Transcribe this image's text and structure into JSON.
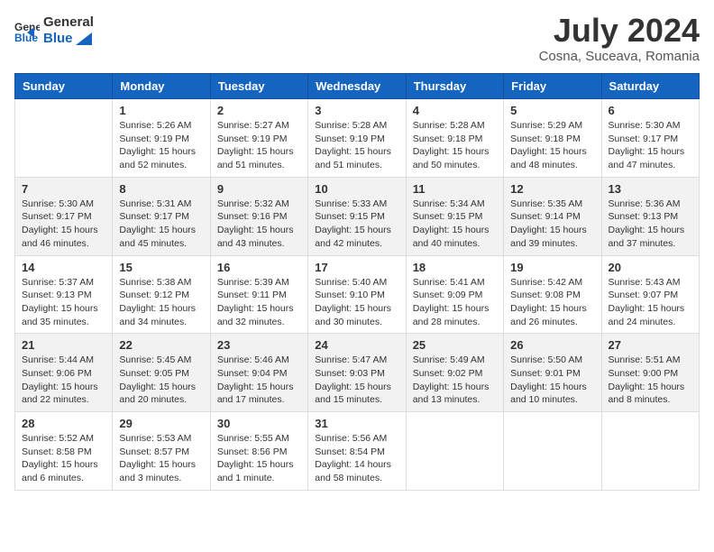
{
  "header": {
    "logo_line1": "General",
    "logo_line2": "Blue",
    "month_year": "July 2024",
    "location": "Cosna, Suceava, Romania"
  },
  "weekdays": [
    "Sunday",
    "Monday",
    "Tuesday",
    "Wednesday",
    "Thursday",
    "Friday",
    "Saturday"
  ],
  "weeks": [
    [
      {
        "day": "",
        "sunrise": "",
        "sunset": "",
        "daylight": ""
      },
      {
        "day": "1",
        "sunrise": "Sunrise: 5:26 AM",
        "sunset": "Sunset: 9:19 PM",
        "daylight": "Daylight: 15 hours and 52 minutes."
      },
      {
        "day": "2",
        "sunrise": "Sunrise: 5:27 AM",
        "sunset": "Sunset: 9:19 PM",
        "daylight": "Daylight: 15 hours and 51 minutes."
      },
      {
        "day": "3",
        "sunrise": "Sunrise: 5:28 AM",
        "sunset": "Sunset: 9:19 PM",
        "daylight": "Daylight: 15 hours and 51 minutes."
      },
      {
        "day": "4",
        "sunrise": "Sunrise: 5:28 AM",
        "sunset": "Sunset: 9:18 PM",
        "daylight": "Daylight: 15 hours and 50 minutes."
      },
      {
        "day": "5",
        "sunrise": "Sunrise: 5:29 AM",
        "sunset": "Sunset: 9:18 PM",
        "daylight": "Daylight: 15 hours and 48 minutes."
      },
      {
        "day": "6",
        "sunrise": "Sunrise: 5:30 AM",
        "sunset": "Sunset: 9:17 PM",
        "daylight": "Daylight: 15 hours and 47 minutes."
      }
    ],
    [
      {
        "day": "7",
        "sunrise": "Sunrise: 5:30 AM",
        "sunset": "Sunset: 9:17 PM",
        "daylight": "Daylight: 15 hours and 46 minutes."
      },
      {
        "day": "8",
        "sunrise": "Sunrise: 5:31 AM",
        "sunset": "Sunset: 9:17 PM",
        "daylight": "Daylight: 15 hours and 45 minutes."
      },
      {
        "day": "9",
        "sunrise": "Sunrise: 5:32 AM",
        "sunset": "Sunset: 9:16 PM",
        "daylight": "Daylight: 15 hours and 43 minutes."
      },
      {
        "day": "10",
        "sunrise": "Sunrise: 5:33 AM",
        "sunset": "Sunset: 9:15 PM",
        "daylight": "Daylight: 15 hours and 42 minutes."
      },
      {
        "day": "11",
        "sunrise": "Sunrise: 5:34 AM",
        "sunset": "Sunset: 9:15 PM",
        "daylight": "Daylight: 15 hours and 40 minutes."
      },
      {
        "day": "12",
        "sunrise": "Sunrise: 5:35 AM",
        "sunset": "Sunset: 9:14 PM",
        "daylight": "Daylight: 15 hours and 39 minutes."
      },
      {
        "day": "13",
        "sunrise": "Sunrise: 5:36 AM",
        "sunset": "Sunset: 9:13 PM",
        "daylight": "Daylight: 15 hours and 37 minutes."
      }
    ],
    [
      {
        "day": "14",
        "sunrise": "Sunrise: 5:37 AM",
        "sunset": "Sunset: 9:13 PM",
        "daylight": "Daylight: 15 hours and 35 minutes."
      },
      {
        "day": "15",
        "sunrise": "Sunrise: 5:38 AM",
        "sunset": "Sunset: 9:12 PM",
        "daylight": "Daylight: 15 hours and 34 minutes."
      },
      {
        "day": "16",
        "sunrise": "Sunrise: 5:39 AM",
        "sunset": "Sunset: 9:11 PM",
        "daylight": "Daylight: 15 hours and 32 minutes."
      },
      {
        "day": "17",
        "sunrise": "Sunrise: 5:40 AM",
        "sunset": "Sunset: 9:10 PM",
        "daylight": "Daylight: 15 hours and 30 minutes."
      },
      {
        "day": "18",
        "sunrise": "Sunrise: 5:41 AM",
        "sunset": "Sunset: 9:09 PM",
        "daylight": "Daylight: 15 hours and 28 minutes."
      },
      {
        "day": "19",
        "sunrise": "Sunrise: 5:42 AM",
        "sunset": "Sunset: 9:08 PM",
        "daylight": "Daylight: 15 hours and 26 minutes."
      },
      {
        "day": "20",
        "sunrise": "Sunrise: 5:43 AM",
        "sunset": "Sunset: 9:07 PM",
        "daylight": "Daylight: 15 hours and 24 minutes."
      }
    ],
    [
      {
        "day": "21",
        "sunrise": "Sunrise: 5:44 AM",
        "sunset": "Sunset: 9:06 PM",
        "daylight": "Daylight: 15 hours and 22 minutes."
      },
      {
        "day": "22",
        "sunrise": "Sunrise: 5:45 AM",
        "sunset": "Sunset: 9:05 PM",
        "daylight": "Daylight: 15 hours and 20 minutes."
      },
      {
        "day": "23",
        "sunrise": "Sunrise: 5:46 AM",
        "sunset": "Sunset: 9:04 PM",
        "daylight": "Daylight: 15 hours and 17 minutes."
      },
      {
        "day": "24",
        "sunrise": "Sunrise: 5:47 AM",
        "sunset": "Sunset: 9:03 PM",
        "daylight": "Daylight: 15 hours and 15 minutes."
      },
      {
        "day": "25",
        "sunrise": "Sunrise: 5:49 AM",
        "sunset": "Sunset: 9:02 PM",
        "daylight": "Daylight: 15 hours and 13 minutes."
      },
      {
        "day": "26",
        "sunrise": "Sunrise: 5:50 AM",
        "sunset": "Sunset: 9:01 PM",
        "daylight": "Daylight: 15 hours and 10 minutes."
      },
      {
        "day": "27",
        "sunrise": "Sunrise: 5:51 AM",
        "sunset": "Sunset: 9:00 PM",
        "daylight": "Daylight: 15 hours and 8 minutes."
      }
    ],
    [
      {
        "day": "28",
        "sunrise": "Sunrise: 5:52 AM",
        "sunset": "Sunset: 8:58 PM",
        "daylight": "Daylight: 15 hours and 6 minutes."
      },
      {
        "day": "29",
        "sunrise": "Sunrise: 5:53 AM",
        "sunset": "Sunset: 8:57 PM",
        "daylight": "Daylight: 15 hours and 3 minutes."
      },
      {
        "day": "30",
        "sunrise": "Sunrise: 5:55 AM",
        "sunset": "Sunset: 8:56 PM",
        "daylight": "Daylight: 15 hours and 1 minute."
      },
      {
        "day": "31",
        "sunrise": "Sunrise: 5:56 AM",
        "sunset": "Sunset: 8:54 PM",
        "daylight": "Daylight: 14 hours and 58 minutes."
      },
      {
        "day": "",
        "sunrise": "",
        "sunset": "",
        "daylight": ""
      },
      {
        "day": "",
        "sunrise": "",
        "sunset": "",
        "daylight": ""
      },
      {
        "day": "",
        "sunrise": "",
        "sunset": "",
        "daylight": ""
      }
    ]
  ]
}
